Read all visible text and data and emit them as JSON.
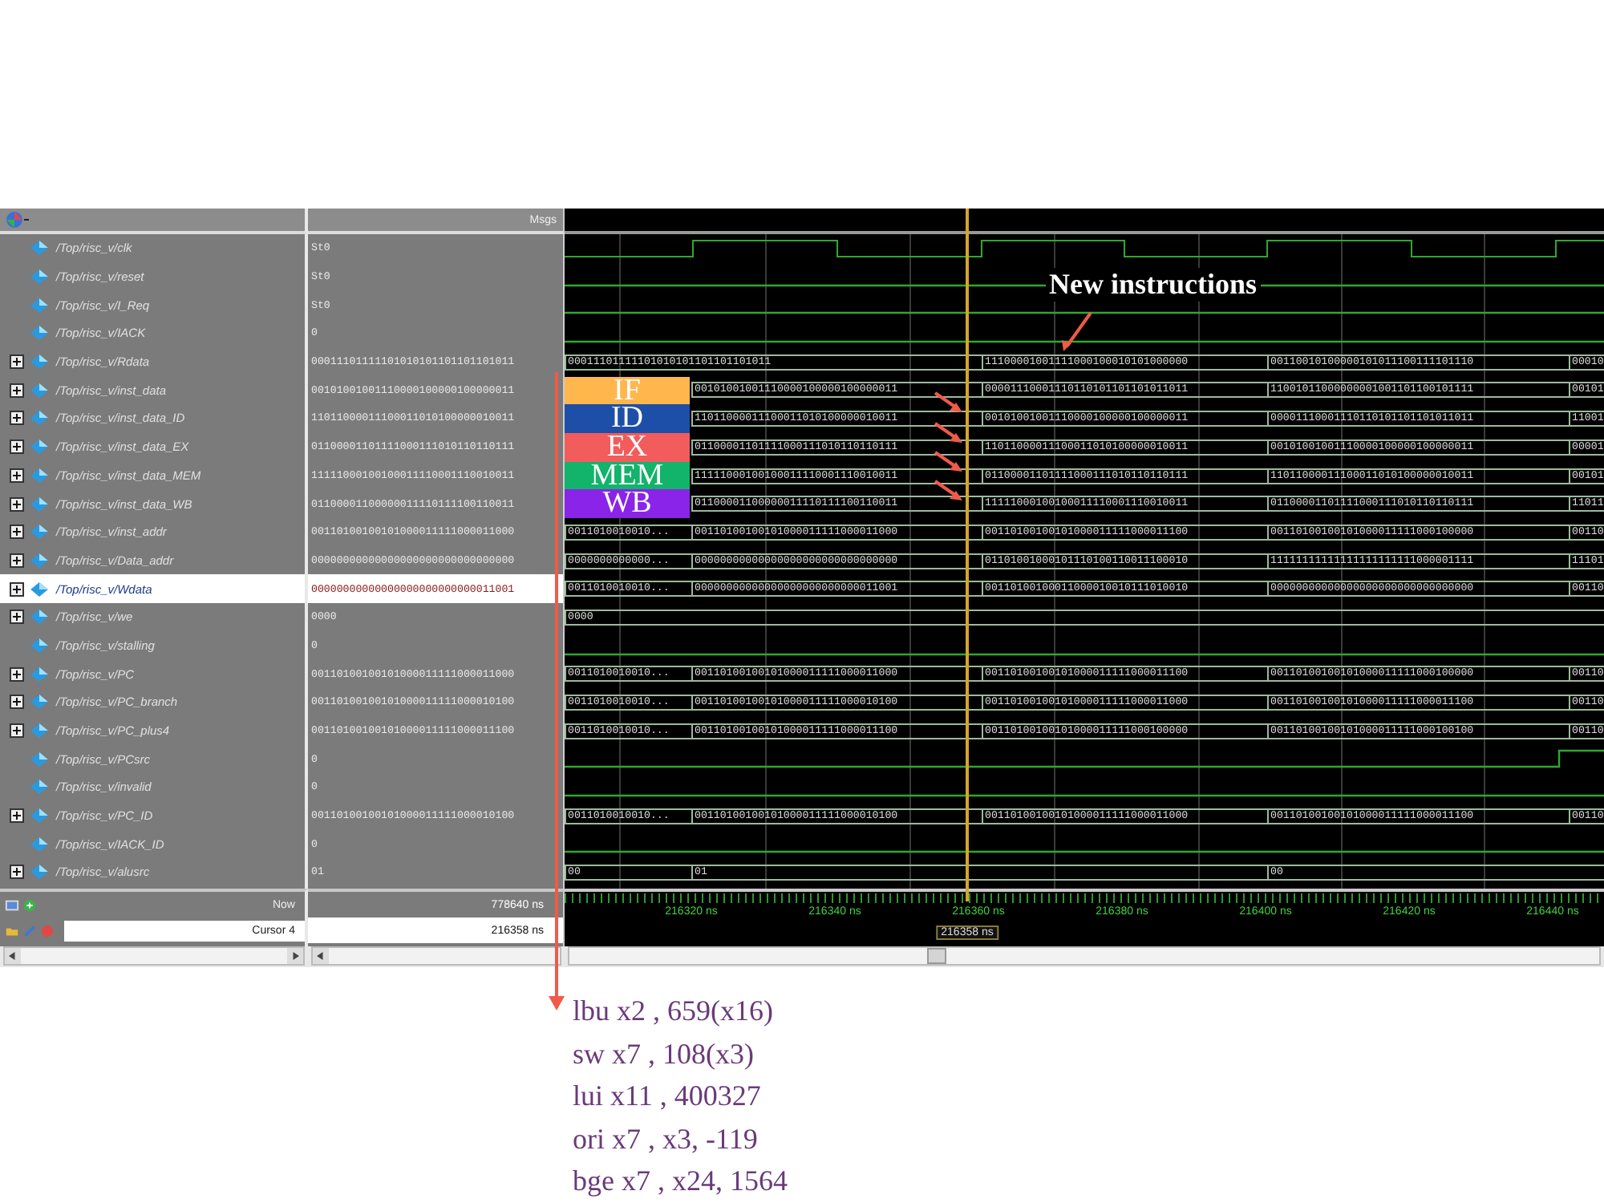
{
  "header": {
    "value_column": "Msgs"
  },
  "signals": [
    {
      "name": "/Top/risc_v/clk",
      "value": "St0",
      "kind": "clock",
      "selected": false
    },
    {
      "name": "/Top/risc_v/reset",
      "value": "St0",
      "kind": "low",
      "selected": false
    },
    {
      "name": "/Top/risc_v/I_Req",
      "value": "St0",
      "kind": "low",
      "selected": false
    },
    {
      "name": "/Top/risc_v/IACK",
      "value": "0",
      "kind": "low",
      "selected": false
    },
    {
      "name": "/Top/risc_v/Rdata",
      "value": "00011101111101010101101101101011",
      "kind": "bus-hold",
      "selected": false,
      "segments": [
        "00011101111101010101101101101011",
        "11100001001111000100010101000000",
        "00110010100000101011100111101110",
        "00010"
      ]
    },
    {
      "name": "/Top/risc_v/inst_data",
      "value": "00101001001110000100000100000011",
      "kind": "bus-staged",
      "selected": false,
      "segments": [
        "00101001001110000100000100000011",
        "00001110001110110101101101011011",
        "11001011000000001001101100101111",
        "00101"
      ]
    },
    {
      "name": "/Top/risc_v/inst_data_ID",
      "value": "11011000011100011010100000010011",
      "kind": "bus-staged",
      "selected": false,
      "segments": [
        "11011000011100011010100000010011",
        "00101001001110000100000100000011",
        "00001110001110110101101101011011",
        "11001"
      ]
    },
    {
      "name": "/Top/risc_v/inst_data_EX",
      "value": "01100001101111000111010110110111",
      "kind": "bus-staged",
      "selected": false,
      "segments": [
        "01100001101111000111010110110111",
        "11011000011100011010100000010011",
        "00101001001110000100000100000011",
        "00001"
      ]
    },
    {
      "name": "/Top/risc_v/inst_data_MEM",
      "value": "11111000100100011110001110010011",
      "kind": "bus-staged",
      "selected": false,
      "segments": [
        "11111000100100011110001110010011",
        "01100001101111000111010110110111",
        "11011000011100011010100000010011",
        "00101"
      ]
    },
    {
      "name": "/Top/risc_v/inst_data_WB",
      "value": "01100001100000011110111100110011",
      "kind": "bus-staged",
      "selected": false,
      "segments": [
        "01100001100000011110111100110011",
        "11111000100100011110001110010011",
        "01100001101111000111010110110111",
        "11011"
      ]
    },
    {
      "name": "/Top/risc_v/inst_addr",
      "value": "00110100100101000011111000011000",
      "kind": "bus",
      "selected": false,
      "segments": [
        "0011010010010...",
        "00110100100101000011111000011000",
        "00110100100101000011111000011100",
        "00110100100101000011111000100000",
        "00110"
      ]
    },
    {
      "name": "/Top/risc_v/Data_addr",
      "value": "00000000000000000000000000000000",
      "kind": "bus",
      "selected": false,
      "segments": [
        "0000000000000...",
        "00000000000000000000000000000000",
        "01101001000101110100110011100010",
        "11111111111111111111111000001111",
        "11101"
      ]
    },
    {
      "name": "/Top/risc_v/Wdata",
      "value": "00000000000000000000000000011001",
      "kind": "bus",
      "selected": true,
      "segments": [
        "0011010010010...",
        "00000000000000000000000000011001",
        "00110100100011000010010111010010",
        "00000000000000000000000000000000",
        "00110"
      ]
    },
    {
      "name": "/Top/risc_v/we",
      "value": "0000",
      "kind": "bus-const",
      "selected": false,
      "segments": [
        "0000"
      ]
    },
    {
      "name": "/Top/risc_v/stalling",
      "value": "0",
      "kind": "low",
      "selected": false
    },
    {
      "name": "/Top/risc_v/PC",
      "value": "00110100100101000011111000011000",
      "kind": "bus",
      "selected": false,
      "segments": [
        "0011010010010...",
        "00110100100101000011111000011000",
        "00110100100101000011111000011100",
        "00110100100101000011111000100000",
        "00110"
      ]
    },
    {
      "name": "/Top/risc_v/PC_branch",
      "value": "00110100100101000011111000010100",
      "kind": "bus",
      "selected": false,
      "segments": [
        "0011010010010...",
        "00110100100101000011111000010100",
        "00110100100101000011111000011000",
        "00110100100101000011111000011100",
        "00110"
      ]
    },
    {
      "name": "/Top/risc_v/PC_plus4",
      "value": "00110100100101000011111000011100",
      "kind": "bus",
      "selected": false,
      "segments": [
        "0011010010010...",
        "00110100100101000011111000011100",
        "00110100100101000011111000100000",
        "00110100100101000011111000100100",
        "00110"
      ]
    },
    {
      "name": "/Top/risc_v/PCsrc",
      "value": "0",
      "kind": "low-rising",
      "selected": false
    },
    {
      "name": "/Top/risc_v/invalid",
      "value": "0",
      "kind": "low",
      "selected": false
    },
    {
      "name": "/Top/risc_v/PC_ID",
      "value": "00110100100101000011111000010100",
      "kind": "bus",
      "selected": false,
      "segments": [
        "0011010010010...",
        "00110100100101000011111000010100",
        "00110100100101000011111000011000",
        "00110100100101000011111000011100",
        "00110"
      ]
    },
    {
      "name": "/Top/risc_v/IACK_ID",
      "value": "0",
      "kind": "low",
      "selected": false
    },
    {
      "name": "/Top/risc_v/alusrc",
      "value": "01",
      "kind": "bus-ctrl",
      "selected": false,
      "segments": [
        "00",
        "01",
        "00"
      ]
    }
  ],
  "footer": {
    "now_label": "Now",
    "now_value": "778640 ns",
    "cursor_label": "Cursor 4",
    "cursor_value": "216358 ns"
  },
  "timeline": {
    "ticks": [
      "216320 ns",
      "216340 ns",
      "216360 ns",
      "216380 ns",
      "216400 ns",
      "216420 ns",
      "216440 ns"
    ],
    "cursor_time": "216358 ns"
  },
  "annotations": {
    "note": "New instructions",
    "stages": [
      {
        "label": "IF",
        "color": "#ffb74d"
      },
      {
        "label": "ID",
        "color": "#1e4fa8"
      },
      {
        "label": "EX",
        "color": "#f25c5c"
      },
      {
        "label": "MEM",
        "color": "#12b36a"
      },
      {
        "label": "WB",
        "color": "#8a24e8"
      }
    ],
    "instructions": [
      "lbu x2 , 659(x16)",
      "sw x7 , 108(x3)",
      "lui x11 , 400327",
      "ori x7 , x3, -119",
      "bge x7 , x24, 1564"
    ]
  }
}
